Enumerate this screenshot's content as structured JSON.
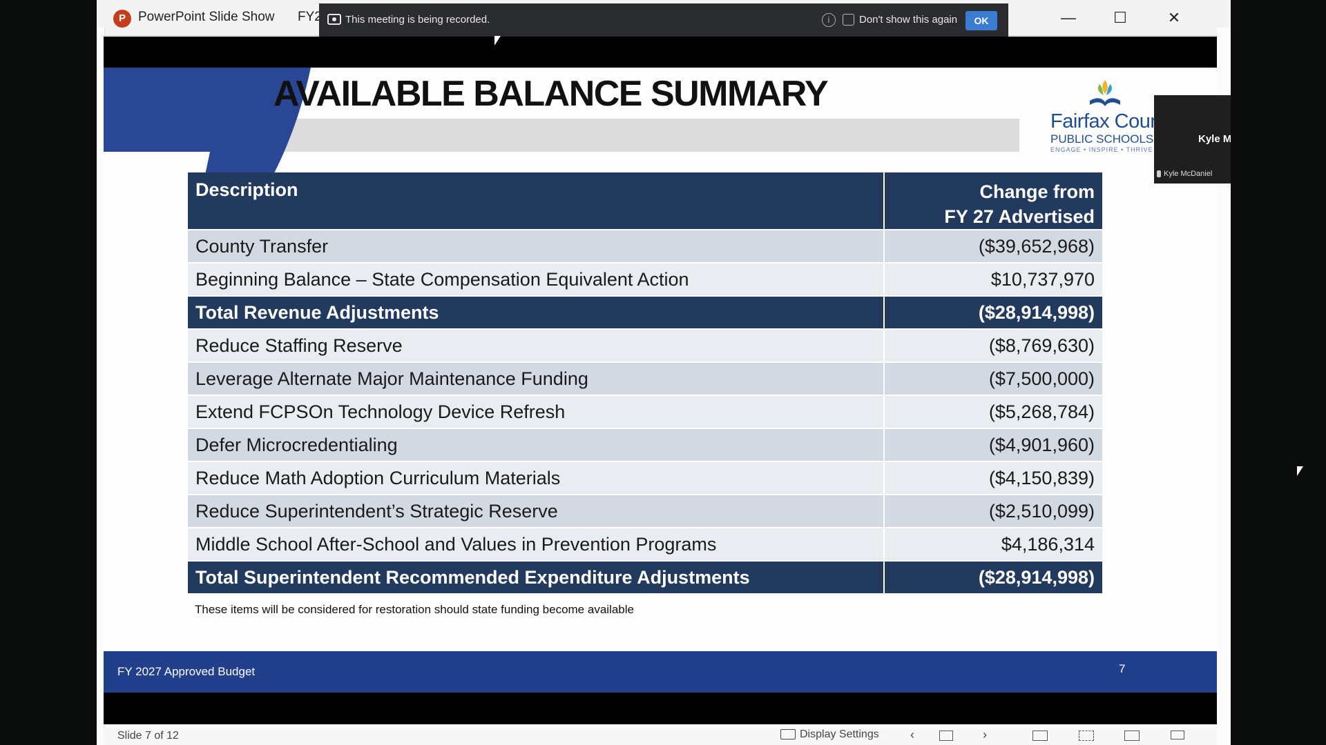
{
  "window": {
    "app_title": "PowerPoint Slide Show",
    "doc_title_fragment": "FY2",
    "controls": {
      "minimize": "—",
      "maximize": "☐",
      "close": "✕"
    }
  },
  "recording_banner": {
    "text": "This meeting is being recorded.",
    "checkbox_label": "Don't show this again",
    "ok_label": "OK",
    "info_icon": "i"
  },
  "slide": {
    "title": "AVAILABLE BALANCE SUMMARY",
    "logo": {
      "name": "Fairfax County",
      "sub": "PUBLIC SCHOOLS",
      "tagline": "ENGAGE • INSPIRE • THRIVE"
    },
    "table": {
      "headers": {
        "description": "Description",
        "change_line1": "Change from",
        "change_line2": "FY 27 Advertised"
      },
      "rows": [
        {
          "description": "County Transfer",
          "amount": "($39,652,968)",
          "style": "mid"
        },
        {
          "description": "Beginning Balance – State Compensation Equivalent Action",
          "amount": "$10,737,970",
          "style": "light"
        },
        {
          "description": "Total Revenue Adjustments",
          "amount": "($28,914,998)",
          "style": "total"
        },
        {
          "description": "Reduce Staffing Reserve",
          "amount": "($8,769,630)",
          "style": "light"
        },
        {
          "description": "Leverage Alternate Major Maintenance Funding",
          "amount": "($7,500,000)",
          "style": "mid"
        },
        {
          "description": "Extend FCPSOn Technology Device Refresh",
          "amount": "($5,268,784)",
          "style": "light"
        },
        {
          "description": "Defer Microcredentialing",
          "amount": "($4,901,960)",
          "style": "mid"
        },
        {
          "description": "Reduce Math Adoption Curriculum Materials",
          "amount": "($4,150,839)",
          "style": "light"
        },
        {
          "description": "Reduce Superintendent’s Strategic Reserve",
          "amount": "($2,510,099)",
          "style": "mid"
        },
        {
          "description": "Middle School After-School and Values in Prevention Programs",
          "amount": "$4,186,314",
          "style": "light"
        },
        {
          "description": "Total Superintendent Recommended Expenditure Adjustments",
          "amount": "($28,914,998)",
          "style": "total"
        }
      ]
    },
    "note": "These items will be considered for restoration should state funding become available",
    "footer_text": "FY 2027 Approved Budget",
    "footer_page": "7"
  },
  "statusbar": {
    "slide_counter": "Slide 7 of 12",
    "display_settings": "Display Settings",
    "prev": "‹",
    "next": "›"
  },
  "participant": {
    "name": "Kyle McDaniel",
    "label": "Kyle McDaniel"
  },
  "colors": {
    "slide_blue": "#2a4796",
    "table_header": "#223a5e",
    "row_light": "#e9ecf1",
    "row_mid": "#d3d9e2",
    "ok_button": "#3b7cd3",
    "app_icon": "#c43e1c"
  }
}
